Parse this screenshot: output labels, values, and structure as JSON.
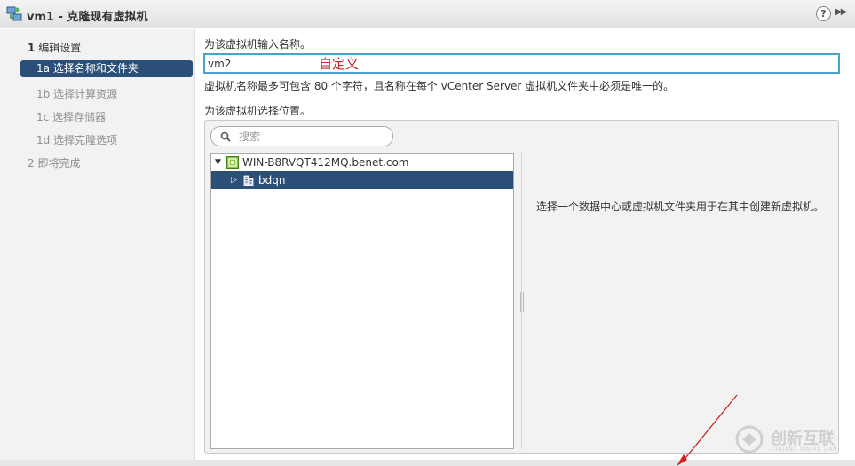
{
  "window": {
    "title": "vm1 - 克隆现有虚拟机",
    "help_label": "?",
    "expand_label": "▶▶"
  },
  "sidebar": {
    "steps": [
      {
        "number": "1",
        "label": "编辑设置",
        "state": "section"
      },
      {
        "number": "1a",
        "label": "选择名称和文件夹",
        "state": "active"
      },
      {
        "number": "1b",
        "label": "选择计算资源",
        "state": "pending"
      },
      {
        "number": "1c",
        "label": "选择存储器",
        "state": "pending"
      },
      {
        "number": "1d",
        "label": "选择克隆选项",
        "state": "pending"
      },
      {
        "number": "2",
        "label": "即将完成",
        "state": "pending"
      }
    ]
  },
  "name_section": {
    "prompt": "为该虚拟机输入名称。",
    "value": "vm2",
    "annotation": "自定义",
    "help_text": "虚拟机名称最多可包含 80 个字符，且名称在每个 vCenter Server 虚拟机文件夹中必须是唯一的。"
  },
  "location_section": {
    "prompt": "为该虚拟机选择位置。",
    "search_placeholder": "搜索",
    "tree": [
      {
        "label": "WIN-B8RVQT412MQ.benet.com",
        "type": "vcenter",
        "expanded": true,
        "selected": false
      },
      {
        "label": "bdqn",
        "type": "datacenter",
        "expanded": false,
        "selected": true
      }
    ],
    "hint": "选择一个数据中心或虚拟机文件夹用于在其中创建新虚拟机。"
  },
  "watermark": {
    "text": "创新互联",
    "subtext": "CHUANG XIN HU LIAN"
  },
  "colors": {
    "accent": "#2c4f77",
    "input_border": "#4aa3c8",
    "annotation_red": "#cc2222"
  }
}
